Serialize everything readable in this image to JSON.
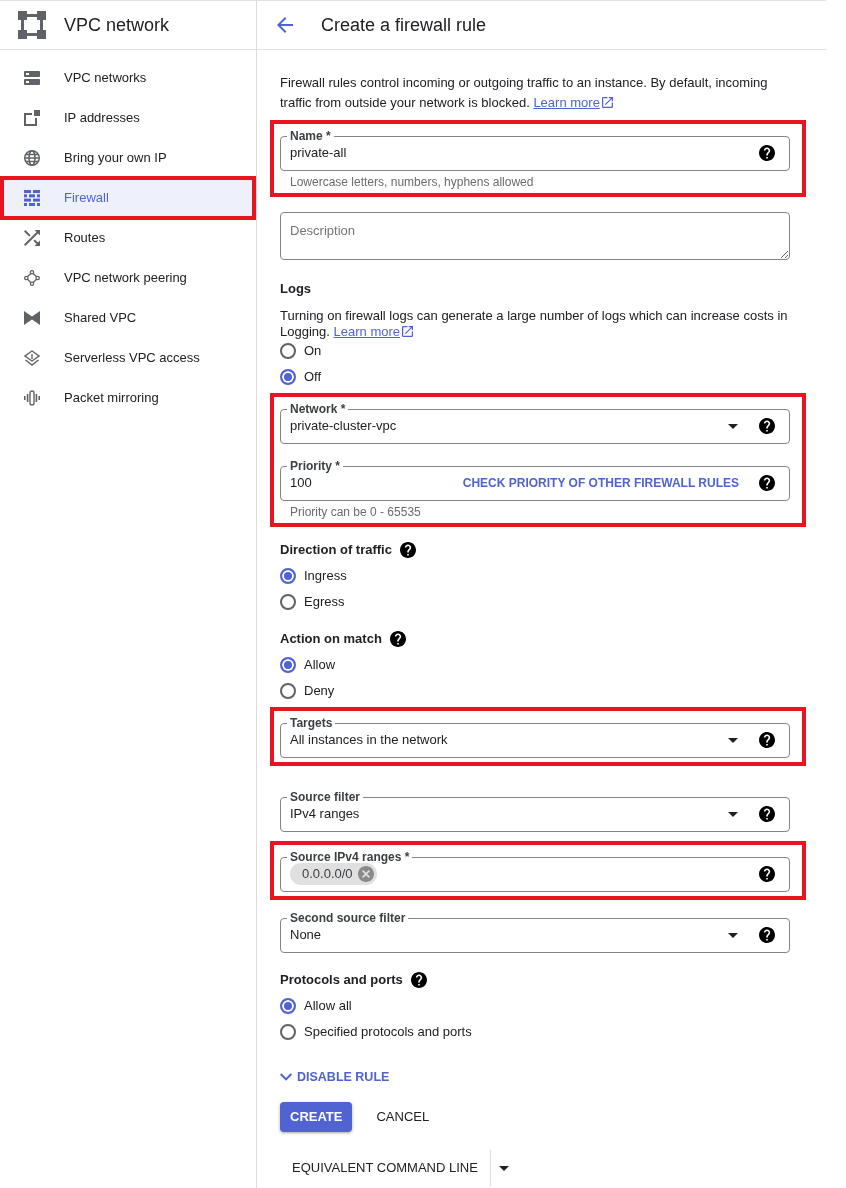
{
  "sidebar": {
    "title": "VPC network",
    "items": [
      {
        "label": "VPC networks",
        "selected": false,
        "highlighted": false
      },
      {
        "label": "IP addresses",
        "selected": false,
        "highlighted": false
      },
      {
        "label": "Bring your own IP",
        "selected": false,
        "highlighted": false
      },
      {
        "label": "Firewall",
        "selected": true,
        "highlighted": true
      },
      {
        "label": "Routes",
        "selected": false,
        "highlighted": false
      },
      {
        "label": "VPC network peering",
        "selected": false,
        "highlighted": false
      },
      {
        "label": "Shared VPC",
        "selected": false,
        "highlighted": false
      },
      {
        "label": "Serverless VPC access",
        "selected": false,
        "highlighted": false
      },
      {
        "label": "Packet mirroring",
        "selected": false,
        "highlighted": false
      }
    ]
  },
  "header": {
    "title": "Create a firewall rule"
  },
  "form": [
    {
      "kind": "description",
      "text": "Firewall rules control incoming or outgoing traffic to an instance. By default, incoming traffic from outside your network is blocked.",
      "link": "Learn more",
      "highlighted": false
    },
    {
      "kind": "text",
      "label": "Name *",
      "value": "private-all",
      "hint": "Lowercase letters, numbers, hyphens allowed",
      "help": true,
      "highlighted": true
    },
    {
      "kind": "textarea",
      "placeholder": "Description",
      "highlighted": false
    },
    {
      "kind": "heading",
      "text": "Logs",
      "help": false,
      "highlighted": false
    },
    {
      "kind": "note",
      "text": "Turning on firewall logs can generate a large number of logs which can increase costs in Logging.",
      "link": "Learn more",
      "highlighted": false
    },
    {
      "kind": "radio",
      "options": [
        {
          "label": "On",
          "selected": false
        },
        {
          "label": "Off",
          "selected": true
        }
      ],
      "highlighted": false
    },
    {
      "kind": "select",
      "label": "Network *",
      "value": "private-cluster-vpc",
      "help": true,
      "highlighted": true
    },
    {
      "kind": "text",
      "label": "Priority *",
      "value": "100",
      "action": "CHECK PRIORITY OF OTHER FIREWALL RULES",
      "hint": "Priority can be 0 - 65535",
      "help": true,
      "highlighted": true
    },
    {
      "kind": "heading",
      "text": "Direction of traffic",
      "help": true,
      "highlighted": false
    },
    {
      "kind": "radio",
      "options": [
        {
          "label": "Ingress",
          "selected": true
        },
        {
          "label": "Egress",
          "selected": false
        }
      ],
      "highlighted": false
    },
    {
      "kind": "heading",
      "text": "Action on match",
      "help": true,
      "highlighted": false
    },
    {
      "kind": "radio",
      "options": [
        {
          "label": "Allow",
          "selected": true
        },
        {
          "label": "Deny",
          "selected": false
        }
      ],
      "highlighted": false
    },
    {
      "kind": "select",
      "label": "Targets",
      "value": "All instances in the network",
      "help": true,
      "highlighted": true
    },
    {
      "kind": "select",
      "label": "Source filter",
      "value": "IPv4 ranges",
      "help": true,
      "highlighted": false
    },
    {
      "kind": "chips",
      "label": "Source IPv4 ranges *",
      "chips": [
        "0.0.0.0/0"
      ],
      "help": true,
      "highlighted": true
    },
    {
      "kind": "select",
      "label": "Second source filter",
      "value": "None",
      "help": true,
      "highlighted": false
    },
    {
      "kind": "heading",
      "text": "Protocols and ports",
      "help": true,
      "highlighted": false
    },
    {
      "kind": "radio",
      "options": [
        {
          "label": "Allow all",
          "selected": true
        },
        {
          "label": "Specified protocols and ports",
          "selected": false
        }
      ],
      "highlighted": false
    },
    {
      "kind": "expander",
      "label": "DISABLE RULE",
      "expanded": false,
      "highlighted": false
    },
    {
      "kind": "buttons",
      "buttons": [
        {
          "label": "CREATE",
          "kind": "primary"
        },
        {
          "label": "CANCEL",
          "kind": "text"
        }
      ],
      "highlighted": false
    },
    {
      "kind": "split_button",
      "label": "EQUIVALENT COMMAND LINE",
      "highlighted": false
    }
  ]
}
